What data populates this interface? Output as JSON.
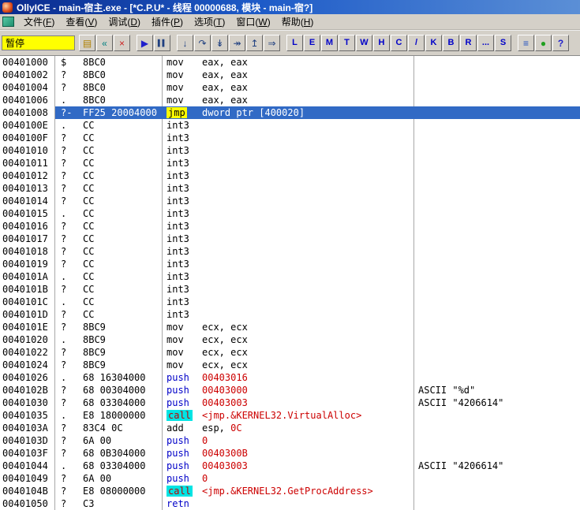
{
  "window": {
    "title": "OllyICE - main-宿主.exe - [*C.P.U* - 线程 00000688, 模块 - main-宿?]"
  },
  "menu": {
    "items": [
      {
        "name": "file",
        "text": "文件",
        "key": "F"
      },
      {
        "name": "view",
        "text": "查看",
        "key": "V"
      },
      {
        "name": "debug",
        "text": "调试",
        "key": "D"
      },
      {
        "name": "plugins",
        "text": "插件",
        "key": "P"
      },
      {
        "name": "options",
        "text": "选项",
        "key": "T"
      },
      {
        "name": "window",
        "text": "窗口",
        "key": "W"
      },
      {
        "name": "help",
        "text": "帮助",
        "key": "H"
      }
    ]
  },
  "toolbar": {
    "status": "暂停",
    "buttons": [
      {
        "name": "open-file-button",
        "icon": "folder-open-icon",
        "kind": "icon",
        "glyph": "▤",
        "color": "#b08000"
      },
      {
        "name": "restart-button",
        "icon": "restart-icon",
        "kind": "icon",
        "glyph": "«",
        "color": "#008080"
      },
      {
        "name": "close-program-button",
        "icon": "close-icon",
        "kind": "icon",
        "glyph": "×",
        "color": "#cc2020"
      },
      {
        "name": "run-button",
        "icon": "play-icon",
        "kind": "icon",
        "glyph": "▶",
        "color": "#2020cc",
        "gap": true
      },
      {
        "name": "pause-button",
        "icon": "pause-icon",
        "kind": "icon",
        "glyph": "▌▌",
        "color": "#204080",
        "size": 8
      },
      {
        "name": "step-into-button",
        "icon": "step-into-icon",
        "kind": "icon",
        "glyph": "↓",
        "color": "#204080",
        "gap": true
      },
      {
        "name": "step-over-button",
        "icon": "step-over-icon",
        "kind": "icon",
        "glyph": "↷",
        "color": "#204080"
      },
      {
        "name": "trace-into-button",
        "icon": "trace-into-icon",
        "kind": "icon",
        "glyph": "↡",
        "color": "#204080"
      },
      {
        "name": "trace-over-button",
        "icon": "trace-over-icon",
        "kind": "icon",
        "glyph": "↠",
        "color": "#204080"
      },
      {
        "name": "execute-till-return-button",
        "icon": "till-return-icon",
        "kind": "icon",
        "glyph": "↥",
        "color": "#204080"
      },
      {
        "name": "go-to-address-button",
        "icon": "goto-icon",
        "kind": "icon",
        "glyph": "⇒",
        "color": "#204080"
      },
      {
        "name": "log-window-button",
        "kind": "letter",
        "glyph": "L",
        "gap": true
      },
      {
        "name": "executables-window-button",
        "kind": "letter",
        "glyph": "E"
      },
      {
        "name": "memory-map-button",
        "kind": "letter",
        "glyph": "M"
      },
      {
        "name": "threads-window-button",
        "kind": "letter",
        "glyph": "T"
      },
      {
        "name": "windows-list-button",
        "kind": "letter",
        "glyph": "W"
      },
      {
        "name": "handles-window-button",
        "kind": "letter",
        "glyph": "H"
      },
      {
        "name": "cpu-window-button",
        "kind": "letter",
        "glyph": "C"
      },
      {
        "name": "patches-window-button",
        "kind": "letter",
        "glyph": "/"
      },
      {
        "name": "call-stack-button",
        "kind": "letter",
        "glyph": "K"
      },
      {
        "name": "breakpoints-window-button",
        "kind": "letter",
        "glyph": "B"
      },
      {
        "name": "references-window-button",
        "kind": "letter",
        "glyph": "R"
      },
      {
        "name": "run-trace-button",
        "kind": "letter",
        "glyph": "..."
      },
      {
        "name": "source-window-button",
        "kind": "letter",
        "glyph": "S"
      },
      {
        "name": "appearance-button",
        "icon": "list-lines-icon",
        "kind": "icon",
        "glyph": "≡",
        "color": "#2050c0",
        "gap": true
      },
      {
        "name": "options-button",
        "icon": "green-dot-icon",
        "kind": "icon",
        "glyph": "●",
        "color": "#20a020"
      },
      {
        "name": "help-button",
        "icon": "question-icon",
        "kind": "icon",
        "glyph": "?",
        "color": "#2020cc",
        "bold": true
      }
    ]
  },
  "disassembly": {
    "rows": [
      {
        "address": "00401000",
        "mark": "$",
        "bytes": "8BC0",
        "mnemonic": "mov",
        "mstyle": "plain",
        "operands": [
          {
            "t": "eax, eax",
            "s": "plain"
          }
        ],
        "comment": ""
      },
      {
        "address": "00401002",
        "mark": "?",
        "bytes": "8BC0",
        "mnemonic": "mov",
        "mstyle": "plain",
        "operands": [
          {
            "t": "eax, eax",
            "s": "plain"
          }
        ],
        "comment": ""
      },
      {
        "address": "00401004",
        "mark": "?",
        "bytes": "8BC0",
        "mnemonic": "mov",
        "mstyle": "plain",
        "operands": [
          {
            "t": "eax, eax",
            "s": "plain"
          }
        ],
        "comment": ""
      },
      {
        "address": "00401006",
        "mark": ".",
        "bytes": "8BC0",
        "mnemonic": "mov",
        "mstyle": "plain",
        "operands": [
          {
            "t": "eax, eax",
            "s": "plain"
          }
        ],
        "comment": ""
      },
      {
        "address": "00401008",
        "mark": "?-",
        "bytes": "FF25 20004000",
        "mnemonic": "jmp",
        "mstyle": "jmp",
        "operands": [
          {
            "t": "dword ptr [400020]",
            "s": "plain"
          }
        ],
        "comment": "",
        "selected": true
      },
      {
        "address": "0040100E",
        "mark": ".",
        "bytes": "CC",
        "mnemonic": "int3",
        "mstyle": "plain",
        "operands": [],
        "comment": ""
      },
      {
        "address": "0040100F",
        "mark": "?",
        "bytes": "CC",
        "mnemonic": "int3",
        "mstyle": "plain",
        "operands": [],
        "comment": ""
      },
      {
        "address": "00401010",
        "mark": "?",
        "bytes": "CC",
        "mnemonic": "int3",
        "mstyle": "plain",
        "operands": [],
        "comment": ""
      },
      {
        "address": "00401011",
        "mark": "?",
        "bytes": "CC",
        "mnemonic": "int3",
        "mstyle": "plain",
        "operands": [],
        "comment": ""
      },
      {
        "address": "00401012",
        "mark": "?",
        "bytes": "CC",
        "mnemonic": "int3",
        "mstyle": "plain",
        "operands": [],
        "comment": ""
      },
      {
        "address": "00401013",
        "mark": "?",
        "bytes": "CC",
        "mnemonic": "int3",
        "mstyle": "plain",
        "operands": [],
        "comment": ""
      },
      {
        "address": "00401014",
        "mark": "?",
        "bytes": "CC",
        "mnemonic": "int3",
        "mstyle": "plain",
        "operands": [],
        "comment": ""
      },
      {
        "address": "00401015",
        "mark": ".",
        "bytes": "CC",
        "mnemonic": "int3",
        "mstyle": "plain",
        "operands": [],
        "comment": ""
      },
      {
        "address": "00401016",
        "mark": "?",
        "bytes": "CC",
        "mnemonic": "int3",
        "mstyle": "plain",
        "operands": [],
        "comment": ""
      },
      {
        "address": "00401017",
        "mark": "?",
        "bytes": "CC",
        "mnemonic": "int3",
        "mstyle": "plain",
        "operands": [],
        "comment": ""
      },
      {
        "address": "00401018",
        "mark": "?",
        "bytes": "CC",
        "mnemonic": "int3",
        "mstyle": "plain",
        "operands": [],
        "comment": ""
      },
      {
        "address": "00401019",
        "mark": "?",
        "bytes": "CC",
        "mnemonic": "int3",
        "mstyle": "plain",
        "operands": [],
        "comment": ""
      },
      {
        "address": "0040101A",
        "mark": ".",
        "bytes": "CC",
        "mnemonic": "int3",
        "mstyle": "plain",
        "operands": [],
        "comment": ""
      },
      {
        "address": "0040101B",
        "mark": "?",
        "bytes": "CC",
        "mnemonic": "int3",
        "mstyle": "plain",
        "operands": [],
        "comment": ""
      },
      {
        "address": "0040101C",
        "mark": ".",
        "bytes": "CC",
        "mnemonic": "int3",
        "mstyle": "plain",
        "operands": [],
        "comment": ""
      },
      {
        "address": "0040101D",
        "mark": "?",
        "bytes": "CC",
        "mnemonic": "int3",
        "mstyle": "plain",
        "operands": [],
        "comment": ""
      },
      {
        "address": "0040101E",
        "mark": "?",
        "bytes": "8BC9",
        "mnemonic": "mov",
        "mstyle": "plain",
        "operands": [
          {
            "t": "ecx, ecx",
            "s": "plain"
          }
        ],
        "comment": ""
      },
      {
        "address": "00401020",
        "mark": ".",
        "bytes": "8BC9",
        "mnemonic": "mov",
        "mstyle": "plain",
        "operands": [
          {
            "t": "ecx, ecx",
            "s": "plain"
          }
        ],
        "comment": ""
      },
      {
        "address": "00401022",
        "mark": "?",
        "bytes": "8BC9",
        "mnemonic": "mov",
        "mstyle": "plain",
        "operands": [
          {
            "t": "ecx, ecx",
            "s": "plain"
          }
        ],
        "comment": ""
      },
      {
        "address": "00401024",
        "mark": "?",
        "bytes": "8BC9",
        "mnemonic": "mov",
        "mstyle": "plain",
        "operands": [
          {
            "t": "ecx, ecx",
            "s": "plain"
          }
        ],
        "comment": ""
      },
      {
        "address": "00401026",
        "mark": ".",
        "bytes": "68 16304000",
        "mnemonic": "push",
        "mstyle": "stack",
        "operands": [
          {
            "t": "00403016",
            "s": "num"
          }
        ],
        "comment": ""
      },
      {
        "address": "0040102B",
        "mark": "?",
        "bytes": "68 00304000",
        "mnemonic": "push",
        "mstyle": "stack",
        "operands": [
          {
            "t": "00403000",
            "s": "num"
          }
        ],
        "comment": "ASCII \"%d\""
      },
      {
        "address": "00401030",
        "mark": "?",
        "bytes": "68 03304000",
        "mnemonic": "push",
        "mstyle": "stack",
        "operands": [
          {
            "t": "00403003",
            "s": "num"
          }
        ],
        "comment": "ASCII \"4206614\""
      },
      {
        "address": "00401035",
        "mark": ".",
        "bytes": "E8 18000000",
        "mnemonic": "call",
        "mstyle": "call",
        "operands": [
          {
            "t": "<jmp.&KERNEL32.VirtualAlloc>",
            "s": "sym"
          }
        ],
        "comment": ""
      },
      {
        "address": "0040103A",
        "mark": "?",
        "bytes": "83C4 0C",
        "mnemonic": "add",
        "mstyle": "plain",
        "operands": [
          {
            "t": "esp, ",
            "s": "plain"
          },
          {
            "t": "0C",
            "s": "num"
          }
        ],
        "comment": ""
      },
      {
        "address": "0040103D",
        "mark": "?",
        "bytes": "6A 00",
        "mnemonic": "push",
        "mstyle": "stack",
        "operands": [
          {
            "t": "0",
            "s": "num"
          }
        ],
        "comment": ""
      },
      {
        "address": "0040103F",
        "mark": "?",
        "bytes": "68 0B304000",
        "mnemonic": "push",
        "mstyle": "stack",
        "operands": [
          {
            "t": "0040300B",
            "s": "num"
          }
        ],
        "comment": ""
      },
      {
        "address": "00401044",
        "mark": ".",
        "bytes": "68 03304000",
        "mnemonic": "push",
        "mstyle": "stack",
        "operands": [
          {
            "t": "00403003",
            "s": "num"
          }
        ],
        "comment": "ASCII \"4206614\""
      },
      {
        "address": "00401049",
        "mark": "?",
        "bytes": "6A 00",
        "mnemonic": "push",
        "mstyle": "stack",
        "operands": [
          {
            "t": "0",
            "s": "num"
          }
        ],
        "comment": ""
      },
      {
        "address": "0040104B",
        "mark": "?",
        "bytes": "E8 08000000",
        "mnemonic": "call",
        "mstyle": "call",
        "operands": [
          {
            "t": "<jmp.&KERNEL32.GetProcAddress>",
            "s": "sym"
          }
        ],
        "comment": ""
      },
      {
        "address": "00401050",
        "mark": "?",
        "bytes": "C3",
        "mnemonic": "retn",
        "mstyle": "stack",
        "operands": [],
        "comment": ""
      }
    ]
  },
  "colors": {
    "selection": "#316ac5",
    "jmp_highlight": "#fcfc00",
    "call_highlight": "#00e4e4",
    "number_text": "#cc0000",
    "stack_mnemonic": "#0000c8",
    "status_bg": "#ffff00",
    "titlebar_blue": "#1e5bc8"
  }
}
